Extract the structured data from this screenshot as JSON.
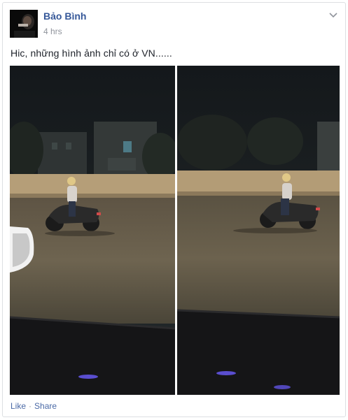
{
  "post": {
    "author_name": "Bảo Bình",
    "timestamp": "4 hrs",
    "message": "Hic, những hình ảnh chỉ có ở VN......",
    "options_icon": "chevron-down-icon",
    "photos": [
      {
        "name": "photo-1",
        "description_icon": "image"
      },
      {
        "name": "photo-2",
        "description_icon": "image"
      }
    ]
  },
  "actions": {
    "like_label": "Like",
    "separator": "·",
    "share_label": "Share"
  },
  "colors": {
    "link": "#365899",
    "muted": "#90949c",
    "border": "#dddfe2"
  }
}
